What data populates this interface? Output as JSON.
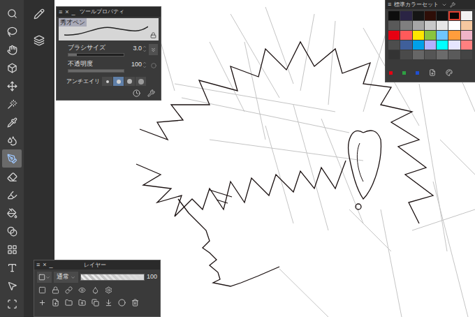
{
  "toolbar": {
    "tools": [
      {
        "selected": false
      },
      {
        "selected": false
      },
      {
        "selected": false
      },
      {
        "selected": false
      },
      {
        "selected": false
      },
      {
        "selected": false
      },
      {
        "selected": false
      },
      {
        "selected": false
      },
      {
        "selected": true
      },
      {
        "selected": false
      },
      {
        "selected": false
      },
      {
        "selected": false
      },
      {
        "selected": false
      },
      {
        "selected": false
      },
      {
        "selected": false
      },
      {
        "selected": false
      },
      {
        "selected": false
      }
    ]
  },
  "tool_property": {
    "header_controls": [
      "≡",
      "×",
      "_"
    ],
    "title": "ツールプロパティ",
    "brush_name": "秀才ペン",
    "brush_size": {
      "label": "ブラシサイズ",
      "value": "3.0",
      "level": 0.15
    },
    "opacity": {
      "label": "不透明度",
      "value": "100",
      "level": 1
    },
    "antialiasing": {
      "label": "アンチエイリ",
      "options": [
        {
          "selected": false
        },
        {
          "selected": true
        },
        {
          "selected": false
        },
        {
          "selected": false
        }
      ]
    }
  },
  "color_set": {
    "header_controls": [
      "≡"
    ],
    "title": "標準カラーセット",
    "swatches": [
      {
        "color": "#0d0d0d",
        "selected": false
      },
      {
        "color": "#2a2444",
        "selected": false
      },
      {
        "color": "#151515",
        "selected": false
      },
      {
        "color": "#2e0e08",
        "selected": false
      },
      {
        "color": "#121212",
        "selected": false
      },
      {
        "color": "#080808",
        "selected": true
      },
      {
        "color": "#f2f2f2",
        "selected": false
      },
      {
        "color": "#595959",
        "selected": false
      },
      {
        "color": "#7f7f7f",
        "selected": false
      },
      {
        "color": "#a6a6a6",
        "selected": false
      },
      {
        "color": "#c8c8c8",
        "selected": false
      },
      {
        "color": "#e6e6e6",
        "selected": false
      },
      {
        "color": "#ffffff",
        "selected": false
      },
      {
        "color": "#f5c8a0",
        "selected": false
      },
      {
        "color": "#e60012",
        "selected": false
      },
      {
        "color": "#ff5a5a",
        "selected": false
      },
      {
        "color": "#ffe600",
        "selected": false
      },
      {
        "color": "#8ac43f",
        "selected": false
      },
      {
        "color": "#6ec6ff",
        "selected": false
      },
      {
        "color": "#ff9d3c",
        "selected": false
      },
      {
        "color": "#f0b4c8",
        "selected": false
      },
      {
        "color": "#4d4d4d",
        "selected": false
      },
      {
        "color": "#3f5f9a",
        "selected": false
      },
      {
        "color": "#00a0e9",
        "selected": false
      },
      {
        "color": "#b2b2ff",
        "selected": false
      },
      {
        "color": "#00ffff",
        "selected": false
      },
      {
        "color": "#e5e5ff",
        "selected": false
      },
      {
        "color": "#ff8080",
        "selected": false
      },
      {
        "color": "#333333",
        "selected": false
      },
      {
        "color": "#4a4a4a",
        "selected": false
      },
      {
        "color": "#666666",
        "selected": false
      },
      {
        "color": "#555555",
        "selected": false
      },
      {
        "color": "#6b6b6b",
        "selected": false
      },
      {
        "color": "#5a5a5a",
        "selected": false
      },
      {
        "color": "#444444",
        "selected": false
      }
    ],
    "marks": [
      {
        "color": "#e60012"
      },
      {
        "color": "#2ea043"
      },
      {
        "color": "#1f4fd1"
      }
    ]
  },
  "layer_panel": {
    "header_controls": [
      "≡",
      "×",
      "_"
    ],
    "title": "レイヤー",
    "blend_mode": "通常",
    "opacity": {
      "value": "100",
      "level": 1
    }
  }
}
